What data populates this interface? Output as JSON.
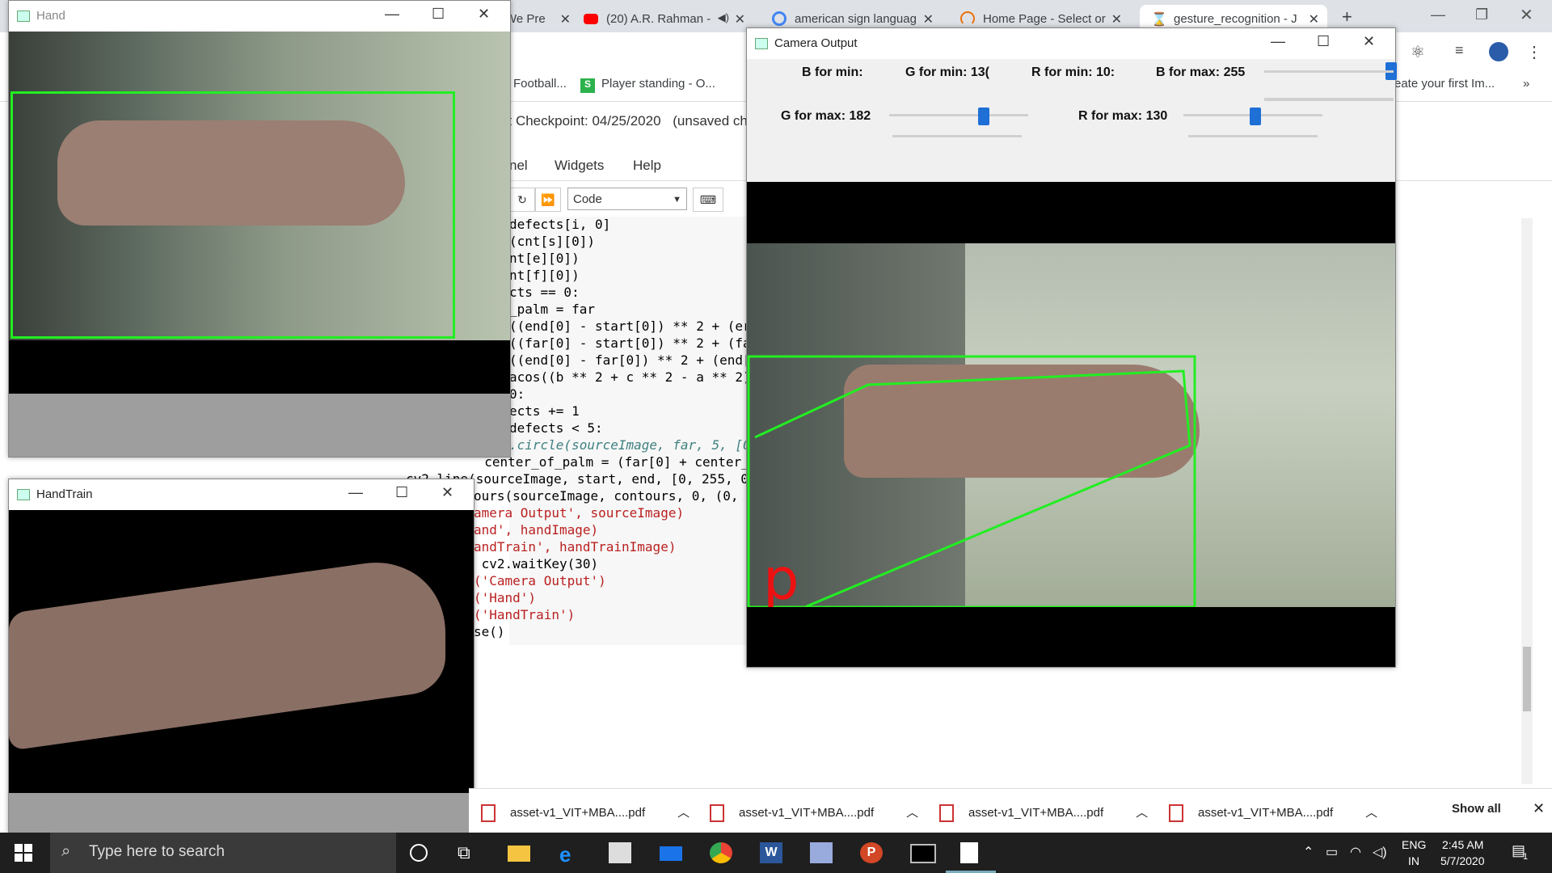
{
  "browser": {
    "tabs": [
      {
        "label": "We Pre",
        "icon": "page-icon"
      },
      {
        "label": "(20) A.R. Rahman -",
        "icon": "youtube-icon"
      },
      {
        "label": "american sign languag",
        "icon": "google-icon"
      },
      {
        "label": "Home Page - Select or",
        "icon": "loading-icon"
      },
      {
        "label": "gesture_recognition - J",
        "icon": "hourglass-icon"
      }
    ],
    "bookmarks": [
      "Football...",
      "Player standing - O...",
      "eate your first Im..."
    ],
    "bookmarks_more": "»"
  },
  "jupyter": {
    "checkpoint": "st Checkpoint: 04/25/2020",
    "unsaved": "(unsaved cha",
    "menu": [
      "nel",
      "Widgets",
      "Help"
    ],
    "cell_type": "Code",
    "code_lines": [
      "defects[i, 0]",
      "(cnt[s][0])",
      "nt[e][0])",
      "nt[f][0])",
      "cts == 0:",
      "_palm = far",
      "((end[0] - start[0]) ** 2 + (er",
      "((far[0] - start[0]) ** 2 + (fa",
      "((end[0] - far[0]) ** 2 + (end[",
      "acos((b ** 2 + c ** 2 - a ** 2)",
      "0:",
      "ects += 1",
      "defects < 5:",
      ".circle(sourceImage, far, 5, [0",
      "  center_of_palm = (far[0] + center_of",
      "cv2.line(sourceImage, start, end, [0, 255, 0",
      "ours(sourceImage, contours, 0, (0, 2",
      "amera Output', sourceImage)",
      "and', handImage)",
      "andTrain', handTrainImage)",
      " cv2.waitKey(30)",
      "('Camera Output')",
      "('Hand')",
      "('HandTrain')",
      "se()"
    ]
  },
  "windows": {
    "hand": {
      "title": "Hand"
    },
    "handtrain": {
      "title": "HandTrain"
    },
    "camera": {
      "title": "Camera Output",
      "b_min": "B for min:",
      "g_min": "G for min: 13(",
      "r_min": "R for min: 10:",
      "b_max": "B for max: 255",
      "g_max": "G for max: 182",
      "r_max": "R for max: 130",
      "g_max_value": 182,
      "r_max_value": 130
    }
  },
  "downloads": {
    "files": [
      "asset-v1_VIT+MBA....pdf",
      "asset-v1_VIT+MBA....pdf",
      "asset-v1_VIT+MBA....pdf",
      "asset-v1_VIT+MBA....pdf"
    ],
    "show_all": "Show all"
  },
  "taskbar": {
    "search_placeholder": "Type here to search",
    "lang": "ENG",
    "region": "IN",
    "time": "2:45 AM",
    "date": "5/7/2020",
    "notifications": "1"
  }
}
